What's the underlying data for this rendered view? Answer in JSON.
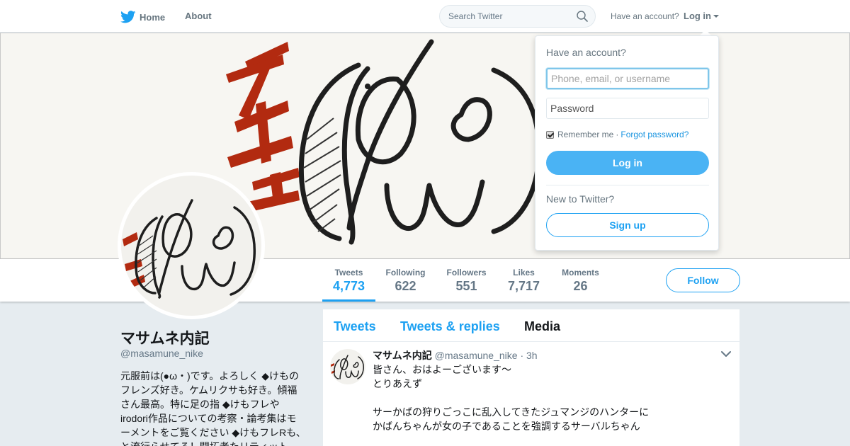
{
  "nav": {
    "home_label": "Home",
    "about_label": "About",
    "search_placeholder": "Search Twitter",
    "have_account": "Have an account?",
    "login_label": "Log in"
  },
  "brand": {
    "accent": "#1da1f2",
    "login_button": "#4ab3f4",
    "link": "#1b95e0",
    "banner_red": "#b22a10"
  },
  "stats": [
    {
      "label": "Tweets",
      "value": "4,773"
    },
    {
      "label": "Following",
      "value": "622"
    },
    {
      "label": "Followers",
      "value": "551"
    },
    {
      "label": "Likes",
      "value": "7,717"
    },
    {
      "label": "Moments",
      "value": "26"
    }
  ],
  "follow_label": "Follow",
  "profile": {
    "name": "マサムネ内記",
    "handle": "@masamune_nike",
    "bio": "元服前は(●ω・)です。よろしく ◆けものフレンズ好き。ケムリクサも好き。傾福さん最高。特に足の指 ◆けもフレやirodori作品についての考察・論考集はモーメントをご覧ください ◆けもフレRも、と流行らせてる！開拓者たリティット"
  },
  "timeline": {
    "tabs": [
      "Tweets",
      "Tweets & replies",
      "Media"
    ],
    "tweet": {
      "name": "マサムネ内記",
      "handle": "@masamune_nike",
      "time": "· 3h",
      "lines": [
        "皆さん、おはよーございます〜",
        "とりあえず",
        "",
        "サーかばの狩りごっこに乱入してきたジュマンジのハンターに",
        "かばんちゃんが女の子であることを強調するサーバルちゃん"
      ]
    }
  },
  "login_dropdown": {
    "title": "Have an account?",
    "username_placeholder": "Phone, email, or username",
    "password_placeholder": "Password",
    "remember": "Remember me",
    "separator": "·",
    "forgot": "Forgot password?",
    "login_button": "Log in",
    "new_to": "New to Twitter?",
    "signup": "Sign up"
  },
  "banner_art": "テメェ (Φω) sketch"
}
